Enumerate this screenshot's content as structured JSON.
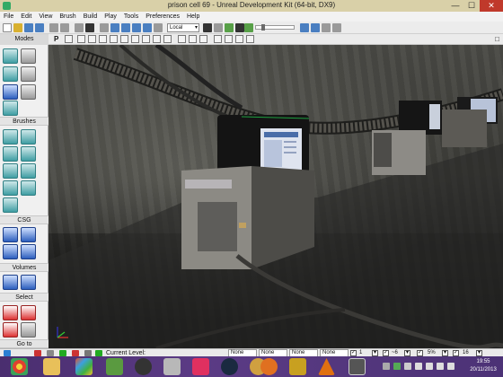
{
  "window": {
    "title": "prison cell 69 - Unreal Development Kit (64-bit, DX9)"
  },
  "menu": [
    "File",
    "Edit",
    "View",
    "Brush",
    "Build",
    "Play",
    "Tools",
    "Preferences",
    "Help"
  ],
  "toolbar": {
    "coordinate_system": "Local"
  },
  "modes_label": "Modes",
  "left_panel": {
    "sections": [
      "Brushes",
      "CSG",
      "Volumes",
      "Select",
      "Go to"
    ]
  },
  "status_bar": {
    "current_level_label": "Current Level:",
    "fields": [
      "None",
      "None",
      "None",
      "None"
    ],
    "grid_value": "1",
    "rotation_value": "~6",
    "scale_value": "5%",
    "extra_value": "16"
  },
  "taskbar": {
    "time": "19:55",
    "date": "20/11/2013"
  },
  "colors": {
    "title_bar": "#d9d0a8",
    "taskbar": "#4a2e6f",
    "close_button": "#c0392b"
  }
}
